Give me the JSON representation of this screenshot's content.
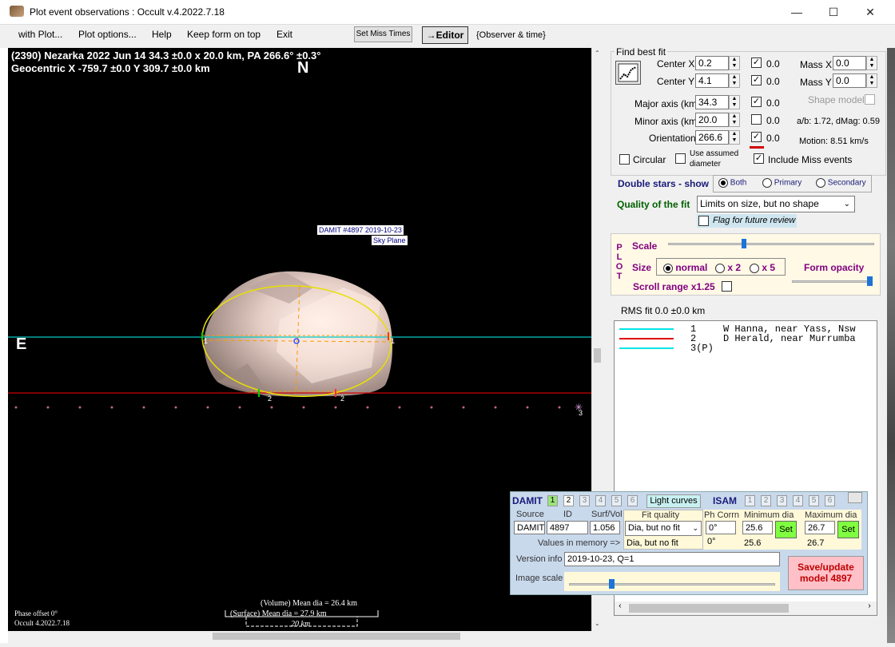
{
  "window": {
    "title": "Plot event observations : Occult v.4.2022.7.18",
    "minimize": "—",
    "maximize": "☐",
    "close": "✕"
  },
  "menu": {
    "items": [
      "with Plot...",
      "Plot options...",
      "Help",
      "Keep form on top",
      "Exit"
    ],
    "set_miss_times": "Set Miss Times",
    "editor": "→Editor",
    "observer_time": "{Observer & time}"
  },
  "plot": {
    "header_line1": "(2390) Nezarka  2022 Jun 14  34.3 ±0.0 x 20.0 km, PA 266.6° ±0.3°",
    "header_line2": "Geocentric  X  -759.7 ±0.0  Y 309.7 ±0.0 km",
    "north": "N",
    "east": "E",
    "damit_label": "DAMIT #4897 2019-10-23",
    "sky_plane": "Sky Plane",
    "chord_labels": [
      "1",
      "1",
      "2",
      "2",
      "3"
    ],
    "volume_dia": "(Volume) Mean dia = 26.4 km",
    "surface_dia": "(Surface) Mean dia = 27.9 km",
    "scale_bar": "20 km",
    "phase_offset": "Phase offset 0°",
    "version": "Occult 4.2022.7.18"
  },
  "bestfit": {
    "group": "Find best fit",
    "center_x_label": "Center X",
    "center_x": "0.2",
    "center_x_chk": "0.0",
    "center_y_label": "Center Y",
    "center_y": "4.1",
    "center_y_chk": "0.0",
    "mass_x_label": "Mass X",
    "mass_x": "0.0",
    "mass_y_label": "Mass Y",
    "mass_y": "0.0",
    "major_label": "Major axis (km)",
    "major": "34.3",
    "major_chk": "0.0",
    "minor_label": "Minor axis (km)",
    "minor": "20.0",
    "minor_chk": "0.0",
    "orient_label": "Orientation",
    "orient": "266.6",
    "orient_chk": "0.0",
    "shape_model": "Shape model",
    "ab_text": "a/b: 1.72, dMag: 0.59",
    "motion": "Motion: 8.51 km/s",
    "circular": "Circular",
    "use_assumed": "Use assumed",
    "diameter": "diameter",
    "include_miss": "Include Miss events"
  },
  "double_stars": {
    "label": "Double stars - show",
    "both": "Both",
    "primary": "Primary",
    "secondary": "Secondary"
  },
  "quality": {
    "label": "Quality of the fit",
    "value": "Limits on size, but no shape",
    "flag": "Flag for future review"
  },
  "plot_panel": {
    "side": "P L O T",
    "scale": "Scale",
    "size": "Size",
    "normal": "normal",
    "x2": "x 2",
    "x5": "x 5",
    "form_opacity": "Form opacity",
    "scroll_range": "Scroll range x1.25"
  },
  "rms": "RMS fit 0.0 ±0.0 km",
  "observers": [
    {
      "num": "1",
      "name": "W Hanna, near Yass, Nsw",
      "color": "#00e5e5"
    },
    {
      "num": "2",
      "name": "D Herald, near Murrumba",
      "color": "#e00000"
    },
    {
      "num": "3(P)",
      "name": "",
      "color": "#00e5e5"
    }
  ],
  "damit": {
    "title": "DAMIT",
    "tabs": [
      "1",
      "2",
      "3",
      "4",
      "5",
      "6"
    ],
    "light_curves": "Light curves",
    "isam": "ISAM",
    "isam_tabs": [
      "1",
      "2",
      "3",
      "4",
      "5",
      "6"
    ],
    "source_h": "Source",
    "id_h": "ID",
    "surfvol_h": "Surf/Vol",
    "fitq_h": "Fit quality",
    "phcorr_h": "Ph Corrn",
    "mindia_h": "Minimum dia",
    "maxdia_h": "Maximum dia",
    "source": "DAMIT",
    "id": "4897",
    "surfvol": "1.056",
    "fitq": "Dia, but no fit",
    "phcorr": "0°",
    "mindia": "25.6",
    "maxdia": "26.7",
    "set": "Set",
    "memory_label": "Values in memory =>",
    "mem_fitq": "Dia, but no fit",
    "mem_phcorr": "0°",
    "mem_min": "25.6",
    "mem_max": "26.7",
    "version_label": "Version info",
    "version": "2019-10-23, Q=1",
    "image_scale": "Image scale",
    "save": "Save/update model 4897"
  }
}
